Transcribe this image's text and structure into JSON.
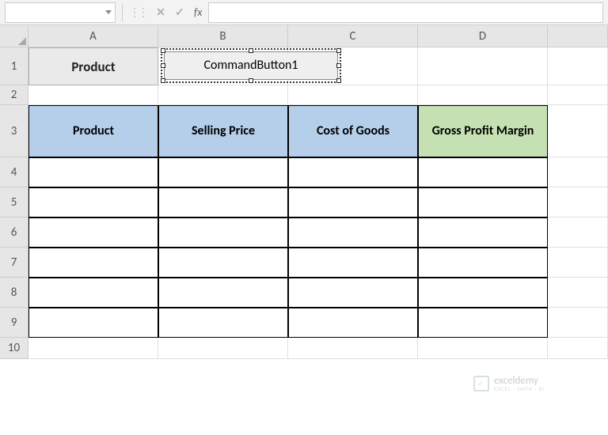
{
  "formula_bar": {
    "name_box_value": "",
    "fx_label": "fx",
    "formula_value": ""
  },
  "columns": [
    "A",
    "B",
    "C",
    "D",
    ""
  ],
  "rows": [
    "1",
    "2",
    "3",
    "4",
    "5",
    "6",
    "7",
    "8",
    "9",
    "10"
  ],
  "cell_a1": "Product",
  "command_button_label": "CommandButton1",
  "table_headers": {
    "col1": "Product",
    "col2": "Selling Price",
    "col3": "Cost of Goods",
    "col4": "Gross Profit Margin"
  },
  "watermark": {
    "title": "exceldemy",
    "subtitle": "EXCEL · DATA · BI"
  },
  "chart_data": {
    "type": "table",
    "columns": [
      "Product",
      "Selling Price",
      "Cost of Goods",
      "Gross Profit Margin"
    ],
    "rows": [
      [
        "",
        "",
        "",
        ""
      ],
      [
        "",
        "",
        "",
        ""
      ],
      [
        "",
        "",
        "",
        ""
      ],
      [
        "",
        "",
        "",
        ""
      ],
      [
        "",
        "",
        "",
        ""
      ],
      [
        "",
        "",
        "",
        ""
      ]
    ]
  }
}
